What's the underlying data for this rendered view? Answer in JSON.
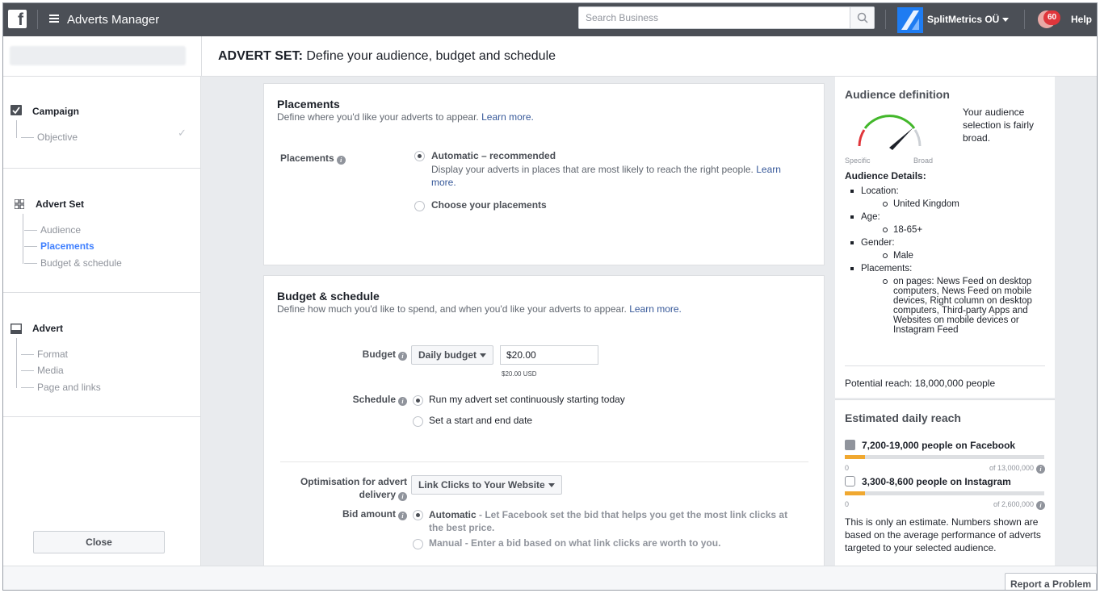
{
  "topbar": {
    "app_title": "Adverts Manager",
    "search_placeholder": "Search Business",
    "account_name": "SplitMetrics OÜ",
    "notification_count": "60",
    "help": "Help"
  },
  "header": {
    "title_prefix": "ADVERT SET:",
    "title_rest": "Define your audience, budget and schedule"
  },
  "sidebar": {
    "campaign": {
      "label": "Campaign",
      "items": [
        "Objective"
      ]
    },
    "advert_set": {
      "label": "Advert Set",
      "items": [
        "Audience",
        "Placements",
        "Budget & schedule"
      ],
      "active": "Placements"
    },
    "advert": {
      "label": "Advert",
      "items": [
        "Format",
        "Media",
        "Page and links"
      ]
    },
    "close_button": "Close"
  },
  "placements": {
    "title": "Placements",
    "subtitle": "Define where you'd like your adverts to appear.",
    "learn_more": "Learn more.",
    "field_label": "Placements",
    "option_auto": "Automatic – recommended",
    "option_auto_desc": "Display your adverts in places that are most likely to reach the right people.",
    "option_auto_link": "Learn more.",
    "option_choose": "Choose your placements",
    "selected": "Automatic – recommended"
  },
  "budget": {
    "title": "Budget & schedule",
    "subtitle": "Define how much you'd like to spend, and when you'd like your adverts to appear.",
    "learn_more": "Learn more.",
    "budget_label": "Budget",
    "budget_type": "Daily budget",
    "budget_value": "$20.00",
    "budget_usd": "$20.00 USD",
    "schedule_label": "Schedule",
    "schedule_opt1": "Run my advert set continuously starting today",
    "schedule_opt2": "Set a start and end date",
    "optimisation_label_1": "Optimisation for advert",
    "optimisation_label_2": "delivery",
    "optimisation_value": "Link Clicks to Your Website",
    "bid_label": "Bid amount",
    "bid_auto_title": "Automatic",
    "bid_auto_desc": "- Let Facebook set the bid that helps you get the most link clicks at the best price.",
    "bid_manual_title": "Manual",
    "bid_manual_desc": "- Enter a bid based on what link clicks are worth to you."
  },
  "audience": {
    "title": "Audience definition",
    "gauge_specific": "Specific",
    "gauge_broad": "Broad",
    "gauge_level": 0.78,
    "summary": "Your audience selection is fairly broad.",
    "details_heading": "Audience Details:",
    "details": [
      {
        "label": "Location:",
        "value": "United Kingdom"
      },
      {
        "label": "Age:",
        "value": "18-65+"
      },
      {
        "label": "Gender:",
        "value": "Male"
      },
      {
        "label": "Placements:",
        "value": "on pages: News Feed on desktop computers, News Feed on mobile devices, Right column on desktop computers, Third-party Apps and Websites on mobile devices or Instagram Feed"
      }
    ],
    "potential_reach": "Potential reach: 18,000,000 people"
  },
  "daily_reach": {
    "title": "Estimated daily reach",
    "facebook": {
      "text": "7,200-19,000 people on Facebook",
      "min": "0",
      "max": "of 13,000,000",
      "fill": 0.1
    },
    "instagram": {
      "text": "3,300-8,600 people on Instagram",
      "min": "0",
      "max": "of 2,600,000",
      "fill": 0.1
    },
    "note": "This is only an estimate. Numbers shown are based on the average performance of adverts targeted to your selected audience."
  },
  "footer": {
    "report": "Report a Problem"
  },
  "colors": {
    "topbar": "#4b4f56",
    "accent": "#4080ff",
    "link": "#365899",
    "reach_bar": "#f0a830"
  }
}
